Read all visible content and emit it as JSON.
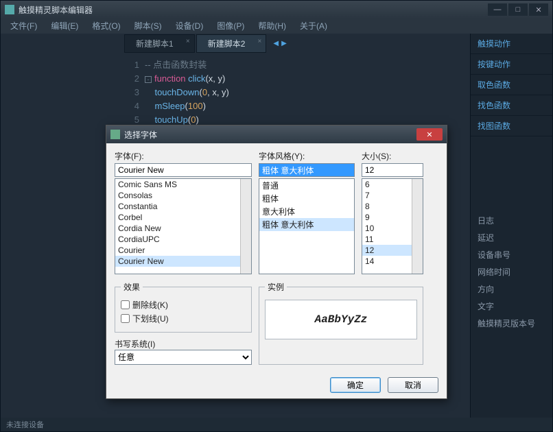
{
  "window": {
    "title": "触摸精灵脚本编辑器"
  },
  "menu": {
    "items": [
      "文件(F)",
      "编辑(E)",
      "格式(O)",
      "脚本(S)",
      "设备(D)",
      "图像(P)",
      "帮助(H)",
      "关于(A)"
    ]
  },
  "tabs": [
    {
      "label": "新建脚本1",
      "active": false
    },
    {
      "label": "新建脚本2",
      "active": true
    }
  ],
  "code": {
    "lines": [
      {
        "n": 1,
        "html": "-- 点击函数封装",
        "cls": "comment"
      },
      {
        "n": 2,
        "html": "function click(x, y)"
      },
      {
        "n": 3,
        "html": "    touchDown(0, x, y)"
      },
      {
        "n": 4,
        "html": "    mSleep(100)"
      },
      {
        "n": 5,
        "html": "    touchUp(0)"
      }
    ]
  },
  "side_panel": {
    "items": [
      "触摸动作",
      "按键动作",
      "取色函数",
      "找色函数",
      "找图函数"
    ],
    "extras": [
      "日志",
      "延迟",
      "设备串号",
      "网络时间",
      "方向",
      "文字",
      "触摸精灵版本号"
    ]
  },
  "statusbar": {
    "text": "未连接设备"
  },
  "font_dialog": {
    "title": "选择字体",
    "font_label": "字体(F):",
    "font_value": "Courier New",
    "font_options": [
      "Comic Sans MS",
      "Consolas",
      "Constantia",
      "Corbel",
      "Cordia New",
      "CordiaUPC",
      "Courier",
      "Courier New"
    ],
    "font_selected": "Courier New",
    "style_label": "字体风格(Y):",
    "style_value": "粗体 意大利体",
    "style_options": [
      "普通",
      "粗体",
      "意大利体",
      "粗体 意大利体"
    ],
    "style_selected": "粗体 意大利体",
    "size_label": "大小(S):",
    "size_value": "12",
    "size_options": [
      "6",
      "7",
      "8",
      "9",
      "10",
      "11",
      "12",
      "14"
    ],
    "size_selected": "12",
    "effects_label": "效果",
    "strike_label": "删除线(K)",
    "underline_label": "下划线(U)",
    "sample_label": "实例",
    "sample_text": "AaBbYyZz",
    "writing_label": "书写系统(I)",
    "writing_value": "任意",
    "ok": "确定",
    "cancel": "取消"
  }
}
